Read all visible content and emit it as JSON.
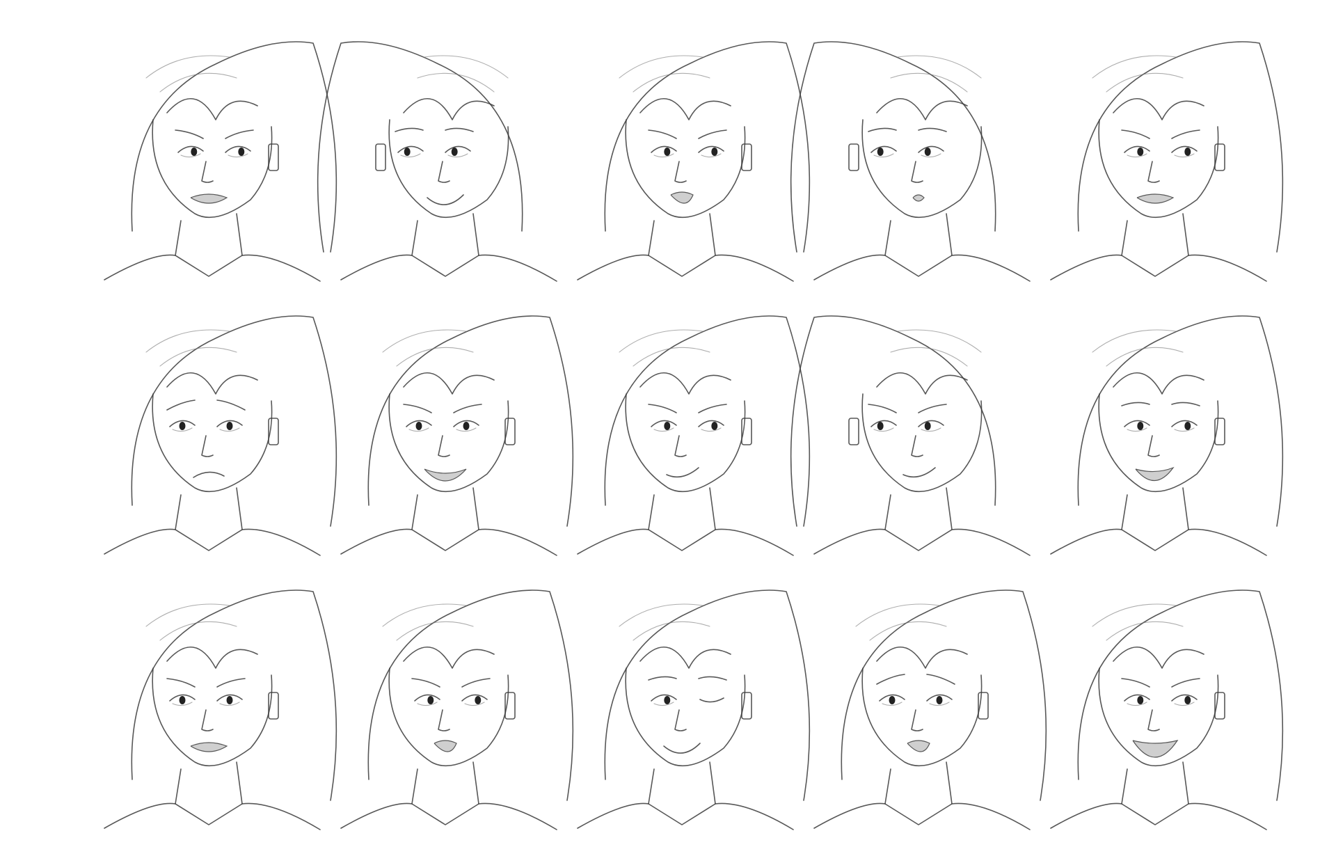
{
  "sheet": {
    "background_color": "#ffffff",
    "line_color": "#3a3a3a",
    "rows": 3,
    "columns": 5
  },
  "expressions": [
    {
      "row": 1,
      "col": 1,
      "mood": "annoyed",
      "head_turn": "right",
      "mouth": "grimace"
    },
    {
      "row": 1,
      "col": 2,
      "mood": "smug",
      "head_turn": "left",
      "mouth": "smile"
    },
    {
      "row": 1,
      "col": 3,
      "mood": "angry-shout",
      "head_turn": "right",
      "mouth": "open"
    },
    {
      "row": 1,
      "col": 4,
      "mood": "pout",
      "head_turn": "left",
      "mouth": "pout"
    },
    {
      "row": 1,
      "col": 5,
      "mood": "snarl",
      "head_turn": "right",
      "mouth": "grimace"
    },
    {
      "row": 2,
      "col": 1,
      "mood": "worried",
      "head_turn": "front",
      "mouth": "frown"
    },
    {
      "row": 2,
      "col": 2,
      "mood": "sinister-grin",
      "head_turn": "front",
      "mouth": "grin"
    },
    {
      "row": 2,
      "col": 3,
      "mood": "scheming",
      "head_turn": "right",
      "mouth": "smirk"
    },
    {
      "row": 2,
      "col": 4,
      "mood": "sly",
      "head_turn": "left",
      "mouth": "smirk"
    },
    {
      "row": 2,
      "col": 5,
      "mood": "cheerful-sneer",
      "head_turn": "right",
      "mouth": "open-smile"
    },
    {
      "row": 3,
      "col": 1,
      "mood": "angry",
      "head_turn": "front",
      "mouth": "grimace"
    },
    {
      "row": 3,
      "col": 2,
      "mood": "furious",
      "head_turn": "right",
      "mouth": "open"
    },
    {
      "row": 3,
      "col": 3,
      "mood": "wink",
      "head_turn": "right",
      "mouth": "smile"
    },
    {
      "row": 3,
      "col": 4,
      "mood": "shocked",
      "head_turn": "front",
      "mouth": "open"
    },
    {
      "row": 3,
      "col": 5,
      "mood": "maniacal-laugh",
      "head_turn": "right",
      "mouth": "laugh"
    }
  ]
}
